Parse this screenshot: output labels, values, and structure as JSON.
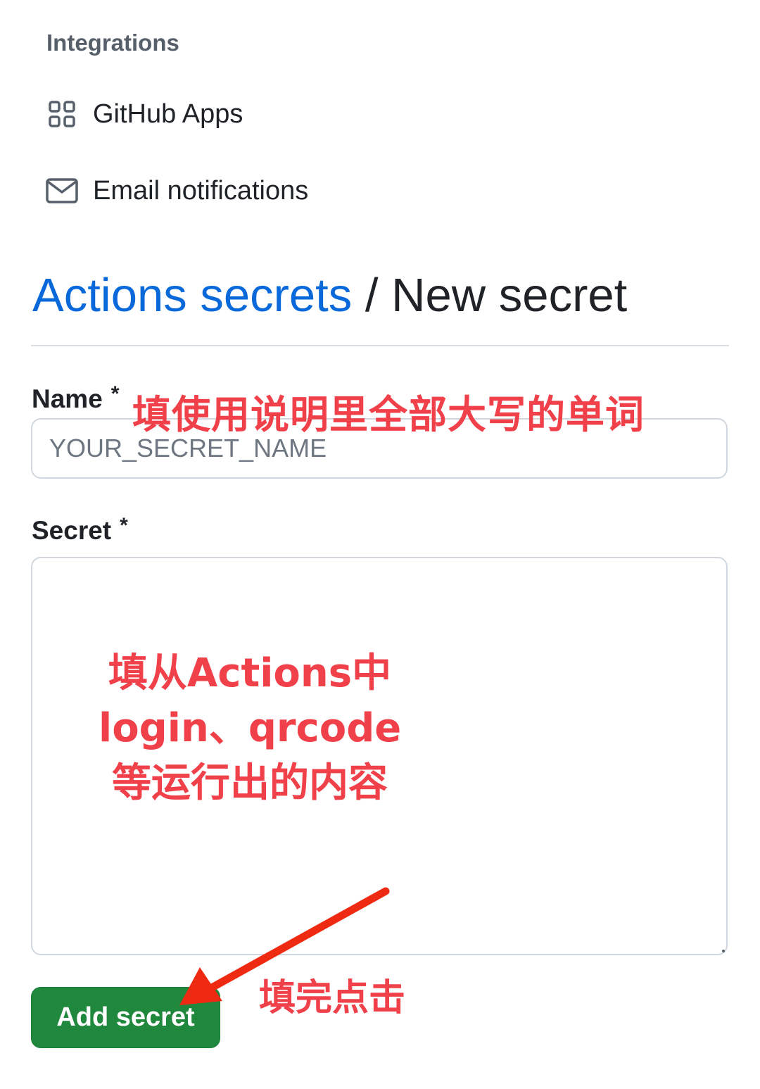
{
  "sidebar": {
    "heading": "Integrations",
    "items": [
      {
        "label": "GitHub Apps",
        "icon": "apps-grid-icon"
      },
      {
        "label": "Email notifications",
        "icon": "mail-icon"
      }
    ]
  },
  "header": {
    "breadcrumb_link": "Actions secrets",
    "separator": "/",
    "current": "New secret"
  },
  "form": {
    "name_label": "Name",
    "name_required": "*",
    "name_placeholder": "YOUR_SECRET_NAME",
    "secret_label": "Secret",
    "secret_required": "*",
    "secret_value": "",
    "submit_label": "Add secret"
  },
  "annotations": {
    "name_hint": "填使用说明里全部大写的单词",
    "secret_hint_lines": [
      "填从Actions中",
      "login、qrcode",
      "等运行出的内容"
    ],
    "click_hint": "填完点击"
  },
  "colors": {
    "link": "#0969da",
    "button": "#1f883d",
    "annotation": "#f0404a",
    "arrow": "#ee2a12"
  }
}
